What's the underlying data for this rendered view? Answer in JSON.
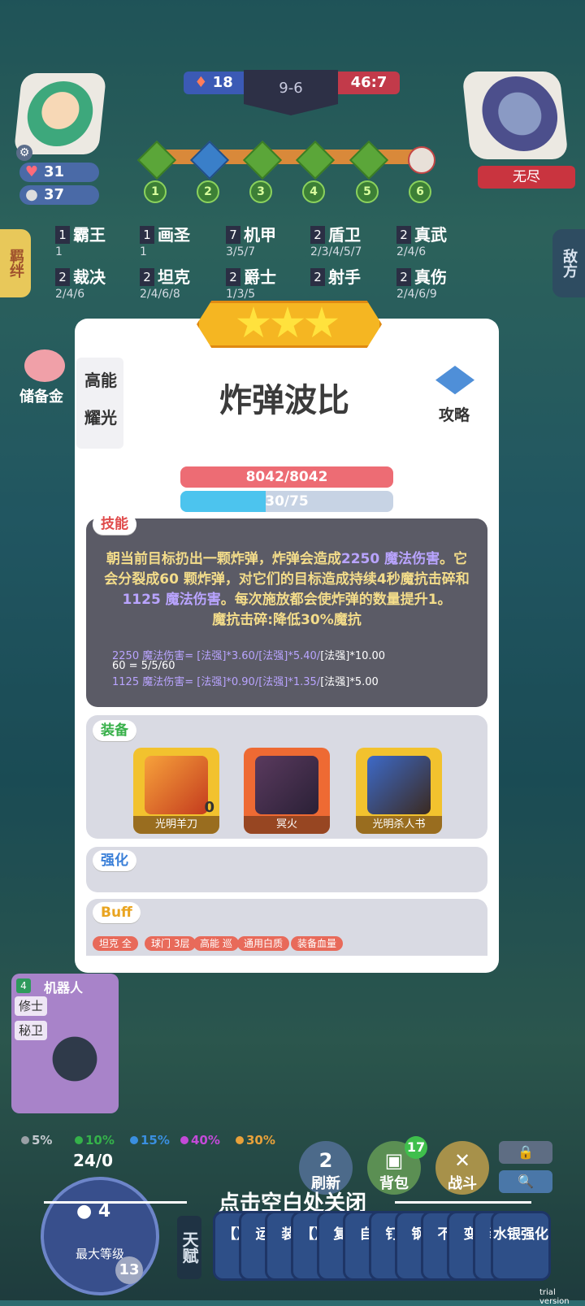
{
  "hud": {
    "player_health": "31",
    "player_gold": "37",
    "score_left": "18",
    "round": "9-6",
    "score_right": "46:7",
    "enemy_name": "无尽",
    "stage_numbers": [
      "1",
      "2",
      "3",
      "4",
      "5",
      "6"
    ],
    "side_tab_left": "羁绊",
    "side_tab_right": "敌方",
    "savings_label": "储备金"
  },
  "traits": [
    {
      "count": "1",
      "name": "霸王",
      "levels": "1"
    },
    {
      "count": "1",
      "name": "画圣",
      "levels": "1"
    },
    {
      "count": "7",
      "name": "机甲",
      "levels": "3/5/7"
    },
    {
      "count": "2",
      "name": "盾卫",
      "levels": "2/3/4/5/7"
    },
    {
      "count": "2",
      "name": "真武",
      "levels": "2/4/6"
    },
    {
      "count": "2",
      "name": "裁决",
      "levels": "2/4/6"
    },
    {
      "count": "2",
      "name": "坦克",
      "levels": "2/4/6/8"
    },
    {
      "count": "2",
      "name": "爵士",
      "levels": "1/3/5"
    },
    {
      "count": "2",
      "name": "射手",
      "levels": ""
    },
    {
      "count": "2",
      "name": "真伤",
      "levels": "2/4/6/9"
    }
  ],
  "modal": {
    "side_traits": [
      "高能",
      "耀光"
    ],
    "hero_name": "炸弹波比",
    "guide_label": "攻略",
    "hp_text": "8042/8042",
    "mana_text": "30/75",
    "mana_fraction": 0.4,
    "skill_tag": "技能",
    "skill_line1": "朝当前目标扔出一颗炸弹，炸弹会造成",
    "skill_hl1": "2250 魔法伤害",
    "skill_line2": "。它会分裂成60 颗炸弹，对它们的目标造成持续4秒魔抗击碎和",
    "skill_hl2": "1125 魔法伤害",
    "skill_line3": "。每次施放都会使炸弹的数量提升1。",
    "skill_line4": "魔抗击碎:降低30%魔抗",
    "formula1_a": "2250 魔法伤害= [法强]*3.60/[法强]*5.40/",
    "formula1_b": "[法强]*10.00",
    "formula2": "60 = 5/5/60",
    "formula3_a": "1125 魔法伤害= [法强]*0.90/[法强]*1.35/",
    "formula3_b": "[法强]*5.00",
    "equip_tag": "装备",
    "equipment": [
      {
        "name": "光明羊刀",
        "badge": "0",
        "color": "#f2c22e"
      },
      {
        "name": "冥火",
        "badge": "",
        "color": "#ee6a33"
      },
      {
        "name": "光明杀人书",
        "badge": "",
        "color": "#f2c22e"
      }
    ],
    "enhance_tag": "强化",
    "buff_tag": "Buff",
    "buff_chips": [
      "坦克 全",
      "球门 3层",
      "高能 巡",
      "通用白质",
      "装备血量"
    ]
  },
  "unit_card": {
    "cost": "4",
    "name": "机器人",
    "traits": [
      "修士",
      "秘卫"
    ]
  },
  "odds": [
    {
      "label": "5%",
      "color": "#9aa0a6"
    },
    {
      "label": "10%",
      "color": "#35b24a"
    },
    {
      "label": "15%",
      "color": "#3a8fe0"
    },
    {
      "label": "40%",
      "color": "#c34ad8"
    },
    {
      "label": "30%",
      "color": "#e8a13a"
    }
  ],
  "level": {
    "xp": "24/0",
    "coin": "4",
    "label": "最大等级",
    "badge": "13"
  },
  "buttons": {
    "refresh_count": "2",
    "refresh_label": "刷新",
    "bag_label": "背包",
    "bag_badge": "17",
    "battle_label": "战斗",
    "lock_icon": "🔒",
    "search_icon": "🔍"
  },
  "close_hint": "点击空白处关闭",
  "talent_label": "天赋",
  "talent_cards": [
    "【】",
    "运",
    "装",
    "【】",
    "复",
    "自",
    "钉",
    "钢",
    "不",
    "变",
    "装",
    "水银强化"
  ],
  "trial": "trial version"
}
